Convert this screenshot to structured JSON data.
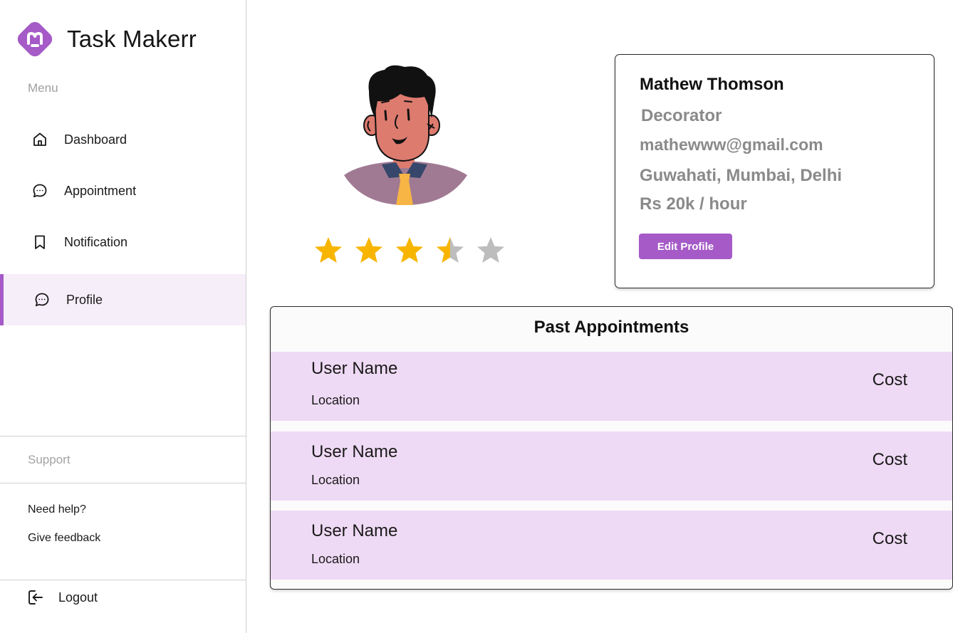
{
  "app": {
    "name": "Task Makerr",
    "accent_color": "#a55ac7"
  },
  "sidebar": {
    "menu_label": "Menu",
    "items": [
      {
        "label": "Dashboard",
        "icon": "home-icon"
      },
      {
        "label": "Appointment",
        "icon": "chat-bubble-icon"
      },
      {
        "label": "Notification",
        "icon": "bookmark-icon"
      },
      {
        "label": "Profile",
        "icon": "chat-bubble-icon",
        "active": true
      }
    ],
    "support_label": "Support",
    "help_links": [
      "Need help?",
      "Give feedback"
    ],
    "logout_label": "Logout"
  },
  "profile": {
    "name": "Mathew Thomson",
    "role": "Decorator",
    "email": "mathewww@gmail.com",
    "locations": "Guwahati, Mumbai, Delhi",
    "rate": "Rs 20k / hour",
    "edit_label": "Edit Profile",
    "rating": 3.5,
    "rating_max": 5,
    "star_color": "#f7b500",
    "star_empty_color": "#bdbdbd"
  },
  "past_appointments": {
    "title": "Past Appointments",
    "rows": [
      {
        "user": "User Name",
        "location": "Location",
        "cost": "Cost"
      },
      {
        "user": "User Name",
        "location": "Location",
        "cost": "Cost"
      },
      {
        "user": "User Name",
        "location": "Location",
        "cost": "Cost"
      }
    ]
  }
}
